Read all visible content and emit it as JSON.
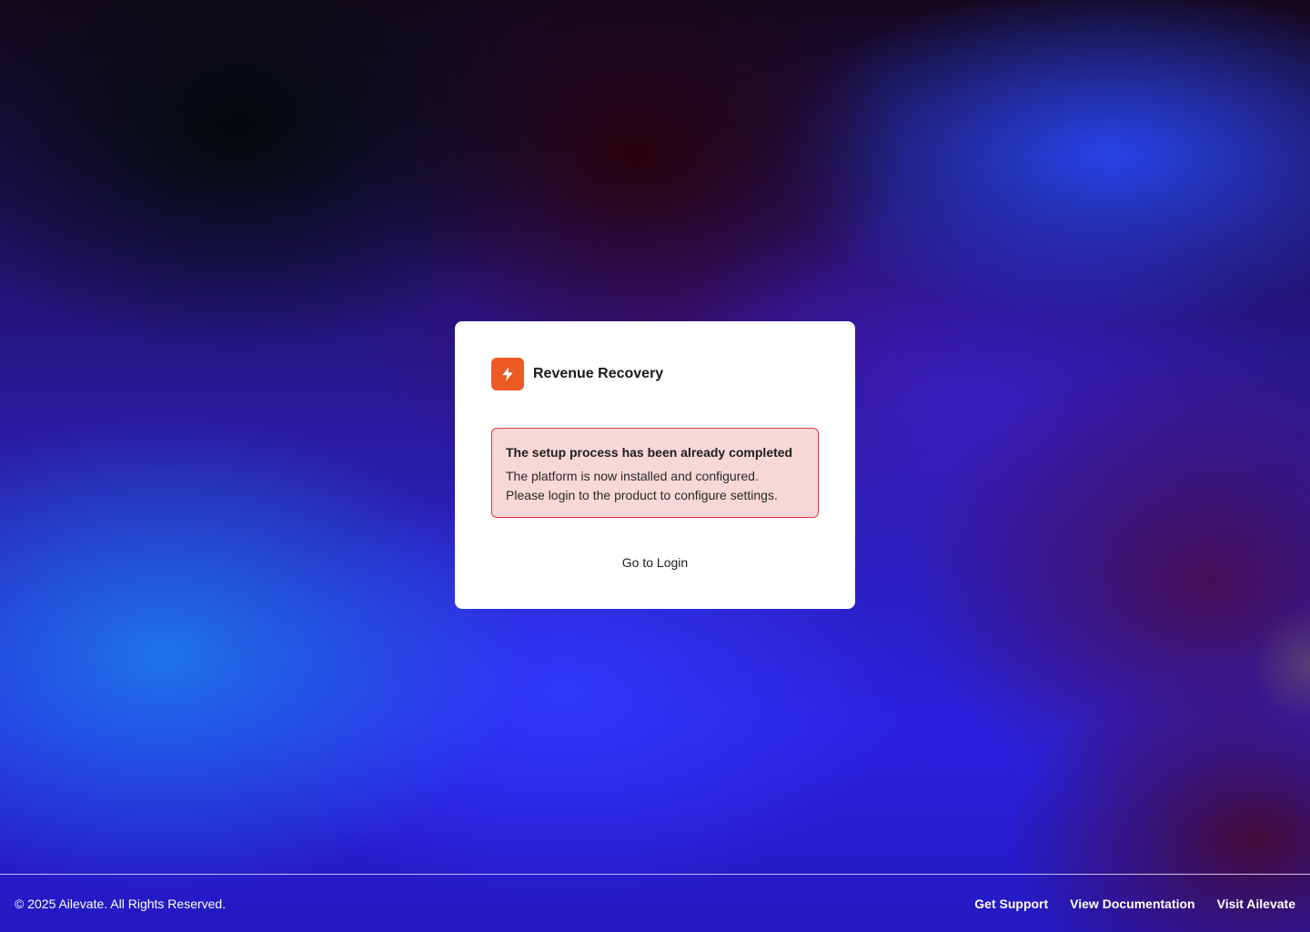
{
  "app": {
    "name": "Revenue Recovery",
    "logo_icon": "lightning-bolt-icon",
    "accent_color": "#ee5a24"
  },
  "alert": {
    "title": "The setup process has been already completed",
    "line1": "The platform is now installed and configured.",
    "line2": "Please login to the product to configure settings.",
    "border_color": "#d9363e",
    "background_color": "#f8d7d8"
  },
  "actions": {
    "login_label": "Go to Login"
  },
  "footer": {
    "copyright": "© 2025 Ailevate. All Rights Reserved.",
    "links": [
      {
        "label": "Get Support"
      },
      {
        "label": "View Documentation"
      },
      {
        "label": "Visit Ailevate"
      }
    ]
  }
}
